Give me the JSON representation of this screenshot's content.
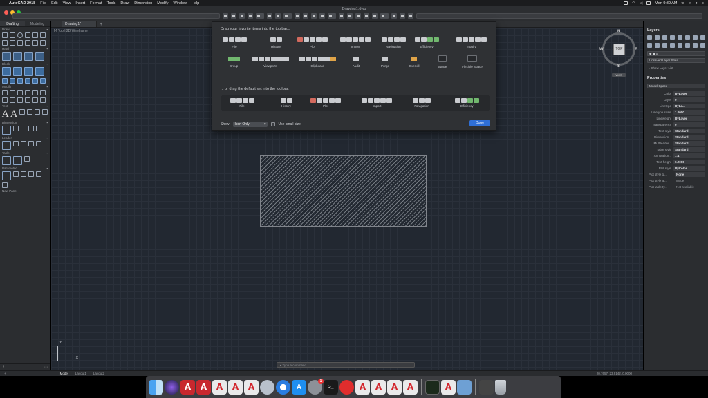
{
  "menubar": {
    "app": "AutoCAD 2018",
    "items": [
      "File",
      "Edit",
      "View",
      "Insert",
      "Format",
      "Tools",
      "Draw",
      "Dimension",
      "Modify",
      "Window",
      "Help"
    ],
    "clock": "Mon 9:39 AM",
    "user": "td"
  },
  "window": {
    "title": "Drawing1.dwg"
  },
  "left_panel": {
    "tabs": [
      "Drafting",
      "Modeling"
    ],
    "sections": [
      "Draw",
      "Hatch",
      "Block",
      "Modify",
      "Text",
      "Dimension",
      "Leader",
      "Table",
      "Parametric",
      "New Panel"
    ]
  },
  "file_tab": "Drawing1*",
  "view_label": "[-] Top | 2D Wireframe",
  "viewcube": {
    "n": "N",
    "s": "S",
    "e": "E",
    "w": "W",
    "face": "TOP",
    "wcs": "WCS"
  },
  "ucs": {
    "x": "X",
    "y": "Y"
  },
  "sheet": {
    "title_favorites": "Drag your favorite items into the toolbar...",
    "title_default": "... or drag the default set into the toolbar.",
    "row1": [
      "File",
      "History",
      "Plot",
      "Import",
      "Navigation",
      "Efficiency",
      "Inquiry"
    ],
    "row2": [
      "Group",
      "Viewports",
      "Clipboard",
      "Audit",
      "Purge",
      "Overkill",
      "Space",
      "Flexible Space"
    ],
    "default_set": [
      "File",
      "History",
      "Plot",
      "Import",
      "Navigation",
      "Efficiency"
    ],
    "show_label": "Show",
    "show_value": "Icon Only",
    "small_size_label": "Use small size",
    "done": "Done"
  },
  "right_panel": {
    "layers_title": "Layers",
    "layer_value": "0",
    "layer_state": "Unsaved Layer State",
    "show_layer_list": "Show Layer List",
    "properties_title": "Properties",
    "model_space": "Model Space",
    "props": [
      {
        "k": "Color",
        "v": "ByLayer"
      },
      {
        "k": "Layer",
        "v": "0"
      },
      {
        "k": "Linetype",
        "v": "ByLa..."
      },
      {
        "k": "Linetype scale",
        "v": "1.0000"
      },
      {
        "k": "Lineweight",
        "v": "ByLayer"
      },
      {
        "k": "Transparency",
        "v": "0"
      },
      {
        "k": "Text style",
        "v": "Standard"
      },
      {
        "k": "Dimension...",
        "v": "Standard"
      },
      {
        "k": "Multileader...",
        "v": "Standard"
      },
      {
        "k": "Table style",
        "v": "Standard"
      },
      {
        "k": "Annotation...",
        "v": "1:1"
      },
      {
        "k": "Text height",
        "v": "0.2000"
      },
      {
        "k": "Plot style",
        "v": "ByColor"
      }
    ],
    "plot_props": [
      {
        "k": "Plot style ta...",
        "v": "None"
      },
      {
        "k": "Plot style at...",
        "v": "Model"
      },
      {
        "k": "Plot table ty...",
        "v": "Not available"
      }
    ]
  },
  "command_placeholder": "Type a command",
  "status": {
    "layouts": [
      "Model",
      "Layout1",
      "Layout2"
    ],
    "coords": "20.7657, 23.9142, 0.0000"
  },
  "dock": {
    "prefs_badge": "1"
  }
}
